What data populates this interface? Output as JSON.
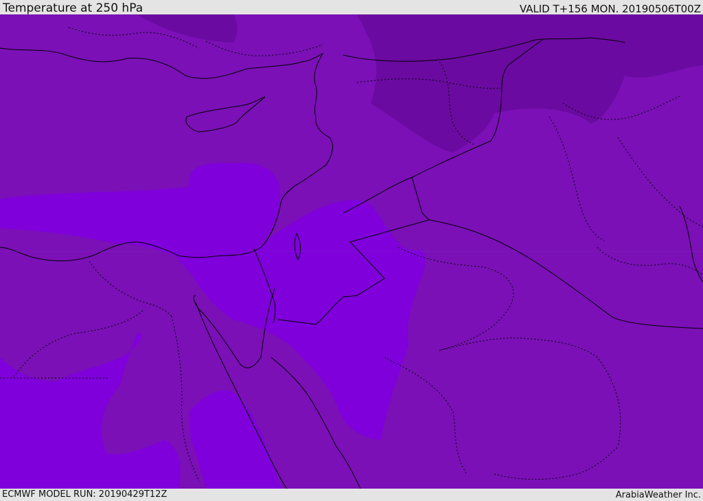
{
  "header": {
    "title": "Temperature at 250 hPa",
    "valid": "VALID T+156 MON. 20190506T00Z"
  },
  "footer": {
    "model_run": "ECMWF MODEL RUN: 20190429T12Z",
    "credit": "ArabiaWeather Inc."
  },
  "map": {
    "region": "Eastern Mediterranean, Levant, Egypt, Arabian Peninsula",
    "fill_colors": {
      "base": "#7a10b6",
      "cold": "#6a0aa0",
      "warm": "#7f00db"
    },
    "coastline_color": "#000000",
    "border_style": "dotted"
  }
}
